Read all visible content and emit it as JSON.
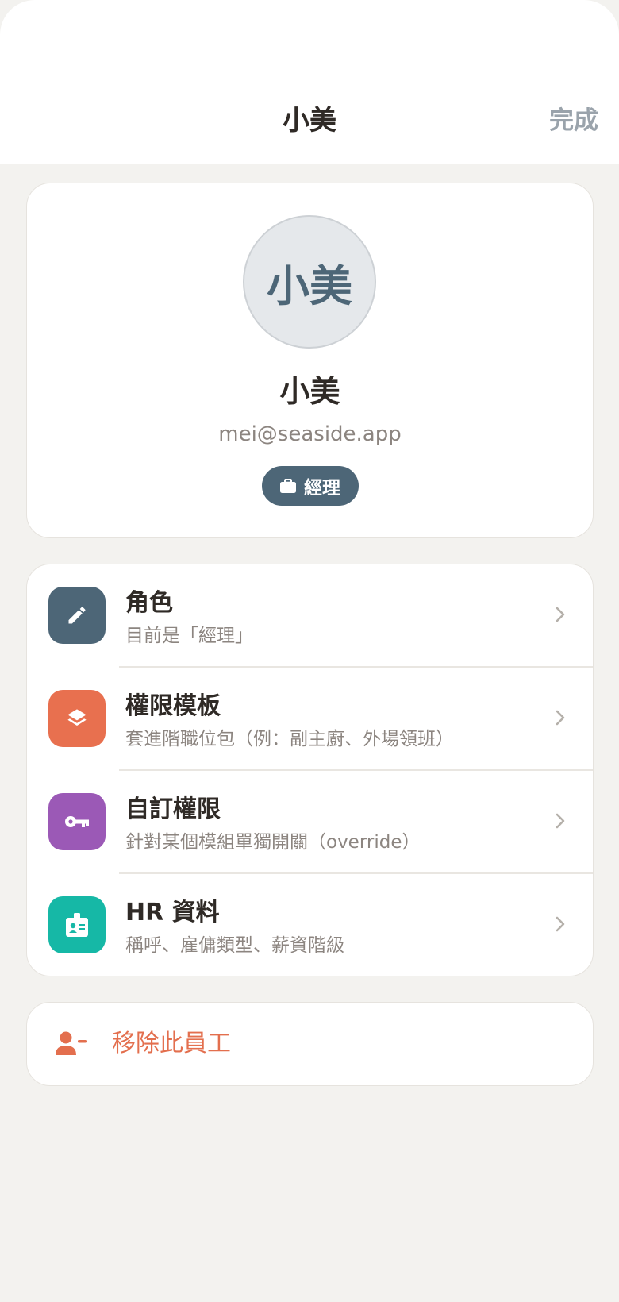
{
  "header": {
    "title": "小美",
    "done_label": "完成"
  },
  "profile": {
    "avatar_text": "小美",
    "name": "小美",
    "email": "mei@seaside.app",
    "role_badge": "經理"
  },
  "menu": {
    "items": [
      {
        "title": "角色",
        "subtitle": "目前是「經理」",
        "icon": "pencil-icon",
        "color": "#4d6677"
      },
      {
        "title": "權限模板",
        "subtitle": "套進階職位包（例：副主廚、外場領班）",
        "icon": "layers-icon",
        "color": "#e8704f"
      },
      {
        "title": "自訂權限",
        "subtitle": "針對某個模組單獨開關（override）",
        "icon": "key-icon",
        "color": "#9b59b6"
      },
      {
        "title": "HR 資料",
        "subtitle": "稱呼、雇傭類型、薪資階級",
        "icon": "id-badge-icon",
        "color": "#16b8a6"
      }
    ]
  },
  "remove": {
    "label": "移除此員工",
    "color": "#e36f4e"
  }
}
